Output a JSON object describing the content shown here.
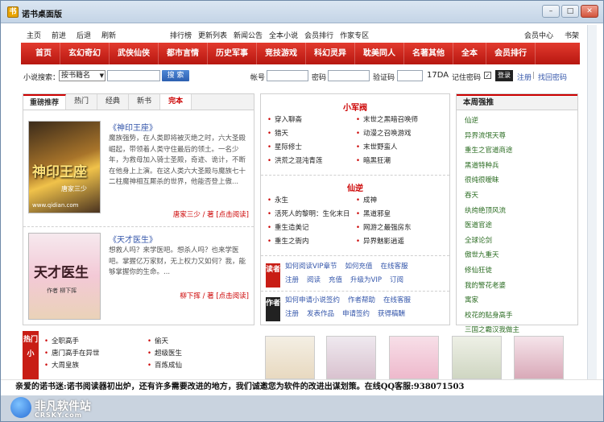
{
  "window": {
    "title": "诺书桌面版",
    "icon": "book-icon",
    "controls": [
      "minimize",
      "maximize",
      "close"
    ]
  },
  "topnav": {
    "left": [
      "主页",
      "前进",
      "后退",
      "刷新"
    ],
    "middle": [
      "排行榜",
      "更新列表",
      "新闻公告",
      "全本小说",
      "会员排行",
      "作家专区"
    ],
    "right": [
      "会员中心",
      "书架"
    ]
  },
  "categories": [
    "首页",
    "玄幻奇幻",
    "武侠仙侠",
    "都市言情",
    "历史军事",
    "竞技游戏",
    "科幻灵异",
    "耽美同人",
    "名著其他",
    "全本",
    "会员排行"
  ],
  "search": {
    "label": "小说搜索：",
    "select_value": "按书籍名",
    "button": "搜 索",
    "account_label": "帐号",
    "password_label": "密码",
    "captcha_label": "验证码",
    "captcha_code": "17DA",
    "remember_label": "记住密码",
    "remember_checked": "✓",
    "login_button": "登录",
    "register": "注册",
    "separator": "|",
    "forgot": "找回密码"
  },
  "recommend": {
    "tabs": [
      "重磅推荐",
      "热门",
      "经典",
      "新书",
      "完本"
    ],
    "active_tab": "完本",
    "books": [
      {
        "title": "《神印王座》",
        "desc": "魔族强势，在人类即将被灭绝之时，六大圣殿崛起，带领着人类守住最后的领土。一名少年，为救母加入骑士圣殿，奇迹、诡计，不断在他身上上演。在这人类六大圣殿与魔族七十二柱魔神相互厮杀的世界，他能否登上傲...",
        "author": "唐家三少 / 著",
        "read": "[点击阅读]",
        "cover_text": "神印王座",
        "cover_sub": "唐家三少",
        "cover_url": "www.qidian.com"
      },
      {
        "title": "《天才医生》",
        "desc": "想救人吗？来学医吧。想杀人吗？也来学医吧。掌握亿万家财，无上权力又如何？我，能够掌握你的生命。...",
        "author": "柳下挥 / 著",
        "read": "[点击阅读]",
        "cover_text": "天才医生",
        "cover_sub": "作者 柳下挥"
      }
    ]
  },
  "xiaojun": {
    "title": "小军阀",
    "left": [
      "穿入聊斋",
      "猎天",
      "星际修士",
      "洪荒之混沌青莲"
    ],
    "right": [
      "末世之黑暗召唤师",
      "动漫之召唤游戏",
      "末世野蛮人",
      "暗黑狂潮"
    ]
  },
  "xianni": {
    "title": "仙逆",
    "left": [
      "永生",
      "活死人的黎明：生化末日",
      "重生造美记",
      "重生之衙内"
    ],
    "right": [
      "成神",
      "黑道邪皇",
      "网游之最强房东",
      "异界魅影逍遥"
    ]
  },
  "reader": {
    "label": "读者",
    "line1": [
      "如何阅读VIP章节",
      "如何充值",
      "在线客服"
    ],
    "line2": [
      "注册",
      "阅读",
      "充值",
      "升级为VIP",
      "订阅"
    ]
  },
  "writer": {
    "label": "作者",
    "line1": [
      "如何申请小说签约",
      "作者帮助",
      "在线客服"
    ],
    "line2": [
      "注册",
      "发表作品",
      "申请签约",
      "获得稿酬"
    ]
  },
  "weekly": {
    "title": "本周强推",
    "items": [
      "仙逆",
      "异界流氓天尊",
      "重生之官道商途",
      "黑道特种兵",
      "很纯很暧昧",
      "吞天",
      "纨绔绝顶风流",
      "医道官途",
      "全球论剑",
      "傲世九重天",
      "修仙狂徒",
      "我的警花老婆",
      "寓家",
      "校花的贴身高手",
      "三国之霸汉我做主"
    ]
  },
  "hot": {
    "label": "热门小",
    "col1": [
      "全职高手",
      "唐门高手在异世",
      "大周皇族"
    ],
    "col2": [
      "偷天",
      "超级医生",
      "百炼成仙"
    ]
  },
  "status_text": "亲爱的诺书迷:诺书阅读器初出炉，还有许多需要改进的地方，我们诚邀您为软件的改进出谋划策。在线QQ客服:938071503",
  "watermark": {
    "cn": "非凡软件站",
    "en": "CRSKY.com"
  }
}
